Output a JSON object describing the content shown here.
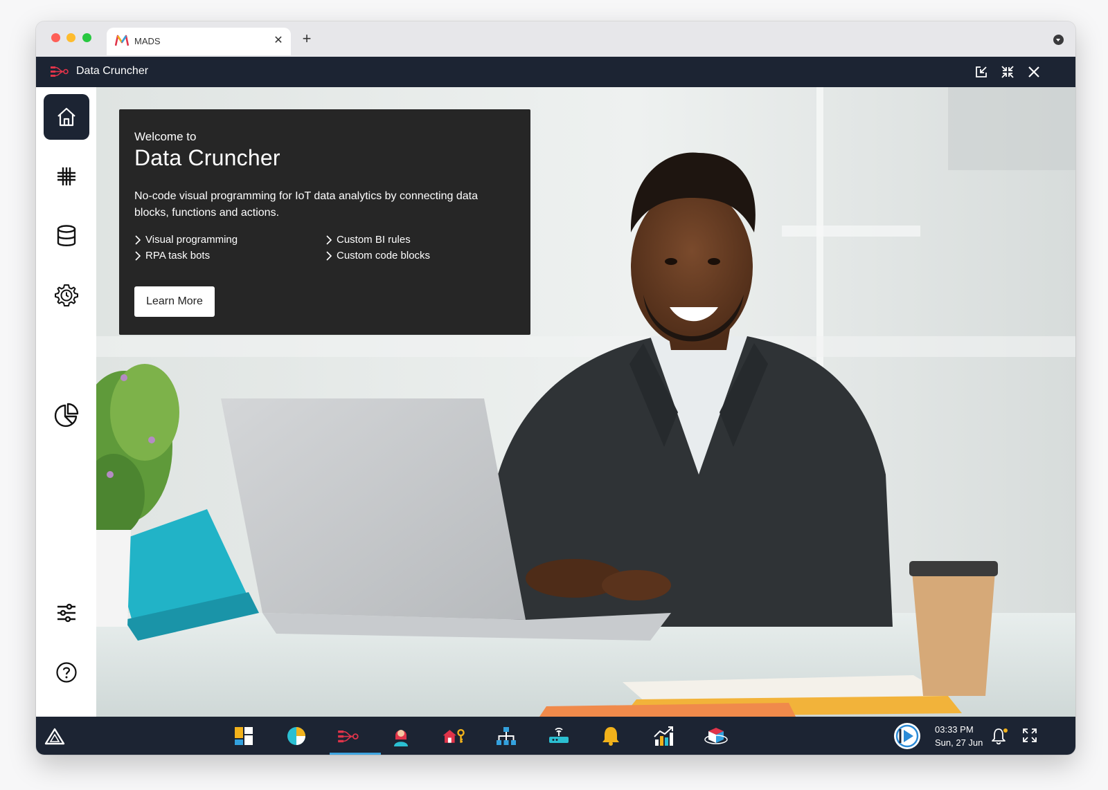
{
  "browser": {
    "tab_title": "MADS",
    "tab_close_icon": "close-icon",
    "new_tab_icon": "plus-icon",
    "menu_icon": "chevron-down-icon"
  },
  "app": {
    "title": "Data Cruncher",
    "actions": [
      "popout-icon",
      "collapse-icon",
      "close-icon"
    ]
  },
  "sidebar": {
    "items": [
      {
        "name": "home",
        "icon": "home-icon",
        "active": true
      },
      {
        "name": "grid",
        "icon": "hashtag-icon",
        "active": false
      },
      {
        "name": "database",
        "icon": "database-icon",
        "active": false
      },
      {
        "name": "scheduler",
        "icon": "gear-clock-icon",
        "active": false
      },
      {
        "name": "analytics",
        "icon": "pie-chart-icon",
        "active": false
      },
      {
        "name": "settings",
        "icon": "sliders-icon",
        "active": false
      },
      {
        "name": "help",
        "icon": "help-icon",
        "active": false
      }
    ]
  },
  "welcome": {
    "subtitle": "Welcome to",
    "title": "Data Cruncher",
    "description": "No-code visual programming for IoT data analytics by connecting data blocks, functions and actions.",
    "features": [
      "Visual programming",
      "RPA task bots",
      "Custom BI rules",
      "Custom code blocks"
    ],
    "button_label": "Learn More"
  },
  "taskbar": {
    "apps": [
      "tiles-icon",
      "pie-chart-icon",
      "data-cruncher-icon",
      "person-icon",
      "home-key-icon",
      "hierarchy-icon",
      "router-icon",
      "bell-icon",
      "growth-chart-icon",
      "cube-icon"
    ],
    "active_app": "data-cruncher-icon",
    "time": "03:33 PM",
    "date": "Sun, 27 Jun"
  },
  "colors": {
    "dark_navy": "#1c2433",
    "accent_blue": "#3fa5e0",
    "brand_red": "#e0344a"
  }
}
